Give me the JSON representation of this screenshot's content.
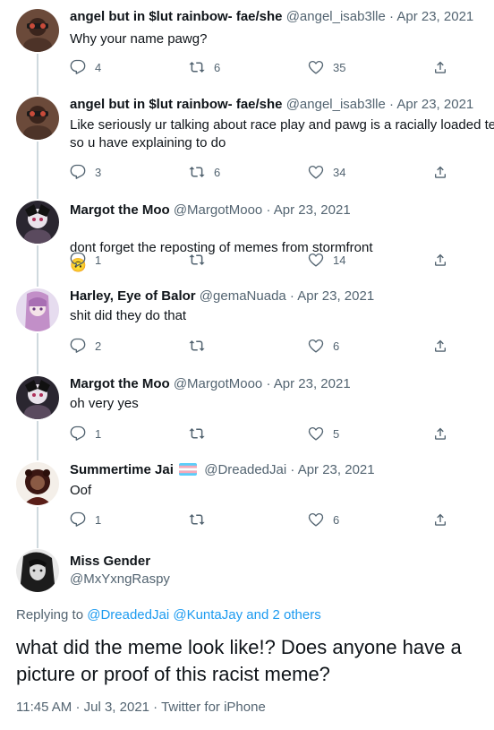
{
  "tweets": [
    {
      "name": "angel but in $lut rainbow- fae/she",
      "handle": "@angel_isab3lle",
      "sep": "·",
      "date": "Apr 23, 2021",
      "text": "Why your name pawg?",
      "replies": "4",
      "retweets": "6",
      "likes": "35"
    },
    {
      "name": "angel but in $lut rainbow- fae/she",
      "handle": "@angel_isab3lle",
      "sep": "·",
      "date": "Apr 23, 2021",
      "text": "Like seriously ur talking about race play and pawg is a racially loaded te\nso u have explaining to do",
      "replies": "3",
      "retweets": "6",
      "likes": "34"
    },
    {
      "name": "Margot the Moo",
      "handle": "@MargotMooo",
      "sep": "·",
      "date": "Apr 23, 2021",
      "text": "dont forget the reposting of memes from stormfront",
      "emoji": "🙃",
      "replies": "1",
      "retweets": "",
      "likes": "14"
    },
    {
      "name": "Harley, Eye of Balor",
      "handle": "@gemaNuada",
      "sep": "·",
      "date": "Apr 23, 2021",
      "text": "shit did they do that",
      "replies": "2",
      "retweets": "",
      "likes": "6"
    },
    {
      "name": "Margot the Moo",
      "handle": "@MargotMooo",
      "sep": "·",
      "date": "Apr 23, 2021",
      "text": "oh very yes",
      "replies": "1",
      "retweets": "",
      "likes": "5"
    },
    {
      "name": "Summertime Jai",
      "handle": "@DreadedJai",
      "sep": "·",
      "date": "Apr 23, 2021",
      "text": "Oof",
      "replies": "1",
      "retweets": "",
      "likes": "6"
    }
  ],
  "focus": {
    "name": "Miss Gender",
    "handle": "@MxYxngRaspy",
    "replying_prefix": "Replying to",
    "replying_to_1": "@DreadedJai",
    "replying_to_2": "@KuntaJay",
    "replying_and": "and",
    "replying_others": "2 others",
    "text": "what did the meme look like!? Does anyone have a picture or proof of this racist meme?",
    "time": "11:45 AM",
    "sep": "·",
    "date": "Jul 3, 2021",
    "source": "Twitter for iPhone"
  },
  "icons": {
    "reply": "reply-icon",
    "retweet": "retweet-icon",
    "like": "heart-icon",
    "share": "share-icon",
    "flag": "trans-flag-icon"
  },
  "colors": {
    "text": "#0f1419",
    "secondary": "#536471",
    "link": "#1d9bf0",
    "thread_line": "#cfd9de"
  }
}
